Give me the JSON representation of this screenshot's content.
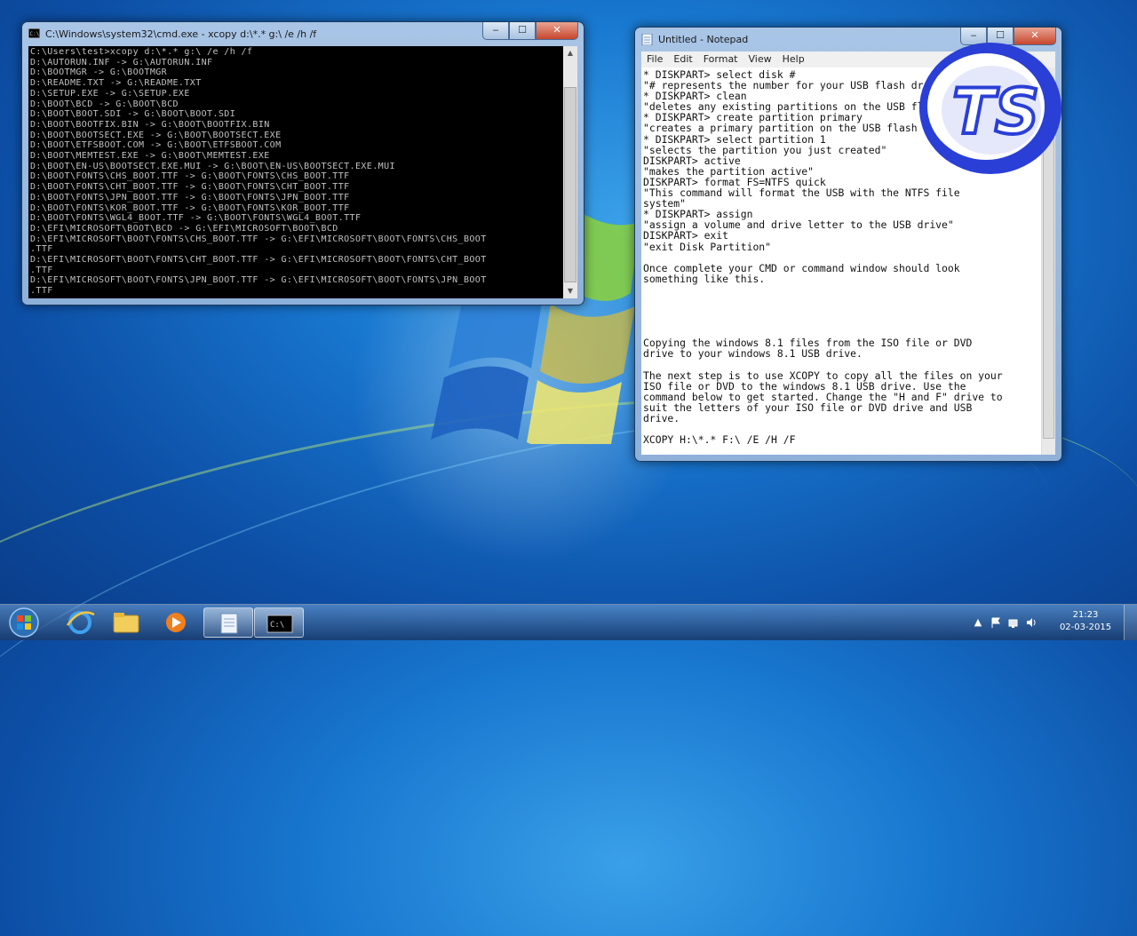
{
  "cmd": {
    "title": "C:\\Windows\\system32\\cmd.exe - xcopy  d:\\*.* g:\\ /e /h /f",
    "lines": [
      "C:\\Users\\test>xcopy d:\\*.* g:\\ /e /h /f",
      "D:\\AUTORUN.INF -> G:\\AUTORUN.INF",
      "D:\\BOOTMGR -> G:\\BOOTMGR",
      "D:\\README.TXT -> G:\\README.TXT",
      "D:\\SETUP.EXE -> G:\\SETUP.EXE",
      "D:\\BOOT\\BCD -> G:\\BOOT\\BCD",
      "D:\\BOOT\\BOOT.SDI -> G:\\BOOT\\BOOT.SDI",
      "D:\\BOOT\\BOOTFIX.BIN -> G:\\BOOT\\BOOTFIX.BIN",
      "D:\\BOOT\\BOOTSECT.EXE -> G:\\BOOT\\BOOTSECT.EXE",
      "D:\\BOOT\\ETFSBOOT.COM -> G:\\BOOT\\ETFSBOOT.COM",
      "D:\\BOOT\\MEMTEST.EXE -> G:\\BOOT\\MEMTEST.EXE",
      "D:\\BOOT\\EN-US\\BOOTSECT.EXE.MUI -> G:\\BOOT\\EN-US\\BOOTSECT.EXE.MUI",
      "D:\\BOOT\\FONTS\\CHS_BOOT.TTF -> G:\\BOOT\\FONTS\\CHS_BOOT.TTF",
      "D:\\BOOT\\FONTS\\CHT_BOOT.TTF -> G:\\BOOT\\FONTS\\CHT_BOOT.TTF",
      "D:\\BOOT\\FONTS\\JPN_BOOT.TTF -> G:\\BOOT\\FONTS\\JPN_BOOT.TTF",
      "D:\\BOOT\\FONTS\\KOR_BOOT.TTF -> G:\\BOOT\\FONTS\\KOR_BOOT.TTF",
      "D:\\BOOT\\FONTS\\WGL4_BOOT.TTF -> G:\\BOOT\\FONTS\\WGL4_BOOT.TTF",
      "D:\\EFI\\MICROSOFT\\BOOT\\BCD -> G:\\EFI\\MICROSOFT\\BOOT\\BCD",
      "D:\\EFI\\MICROSOFT\\BOOT\\FONTS\\CHS_BOOT.TTF -> G:\\EFI\\MICROSOFT\\BOOT\\FONTS\\CHS_BOOT",
      ".TTF",
      "D:\\EFI\\MICROSOFT\\BOOT\\FONTS\\CHT_BOOT.TTF -> G:\\EFI\\MICROSOFT\\BOOT\\FONTS\\CHT_BOOT",
      ".TTF",
      "D:\\EFI\\MICROSOFT\\BOOT\\FONTS\\JPN_BOOT.TTF -> G:\\EFI\\MICROSOFT\\BOOT\\FONTS\\JPN_BOOT",
      ".TTF",
      "_"
    ],
    "buttons": {
      "minimize": "‒",
      "maximize": "☐",
      "close": "✕"
    }
  },
  "notepad": {
    "title": "Untitled - Notepad",
    "menu": [
      "File",
      "Edit",
      "Format",
      "View",
      "Help"
    ],
    "lines": [
      "* DISKPART> select disk #",
      "\"# represents the number for your USB flash dr",
      "* DISKPART> clean",
      "\"deletes any existing partitions on the USB flash drive\"",
      "* DISKPART> create partition primary",
      "\"creates a primary partition on the USB flash drive\"",
      "* DISKPART> select partition 1",
      "\"selects the partition you just created\"",
      "DISKPART> active",
      "\"makes the partition active\"",
      "DISKPART> format FS=NTFS quick",
      "\"This command will format the USB with the NTFS file",
      "system\"",
      "* DISKPART> assign",
      "\"assign a volume and drive letter to the USB drive\"",
      "DISKPART> exit",
      "\"exit Disk Partition\"",
      "",
      "Once complete your CMD or command window should look",
      "something like this.",
      "",
      "",
      "",
      "",
      "",
      "Copying the windows 8.1 files from the ISO file or DVD",
      "drive to your windows 8.1 USB drive.",
      "",
      "The next step is to use XCOPY to copy all the files on your",
      "ISO file or DVD to the windows 8.1 USB drive. Use the",
      "command below to get started. Change the \"H and F\" drive to",
      "suit the letters of your ISO file or DVD drive and USB",
      "drive.",
      "",
      "XCOPY H:\\*.* F:\\ /E /H /F"
    ],
    "buttons": {
      "minimize": "‒",
      "maximize": "☐",
      "close": "✕"
    }
  },
  "logo": {
    "text": "TS"
  },
  "taskbar": {
    "clock_time": "21:23",
    "clock_date": "02-03-2015",
    "tray_arrow": "▲"
  }
}
